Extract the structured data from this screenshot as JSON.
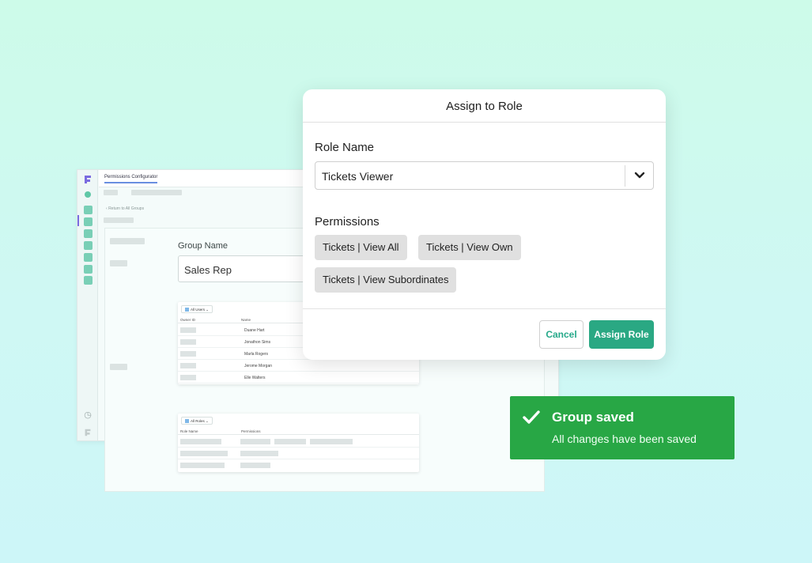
{
  "app": {
    "tab_label": "Permissions Configurator",
    "back_link": "Return to All Groups",
    "group_name_label": "Group Name",
    "group_name_value": "Sales Rep",
    "users_table": {
      "filter_label": "All Users",
      "columns": [
        "Owner ID",
        "Name"
      ],
      "rows": [
        "Duane Hart",
        "Jonathon Sims",
        "Marla Rogers",
        "Jerome Morgan",
        "Elle Walters"
      ]
    },
    "roles_table": {
      "filter_label": "All Roles",
      "columns": [
        "Role Name",
        "Permissions"
      ]
    },
    "sidebar_bottom_icons": [
      "clock-icon",
      "logo-icon"
    ]
  },
  "modal": {
    "title": "Assign to Role",
    "role_name_label": "Role Name",
    "role_name_value": "Tickets Viewer",
    "permissions_label": "Permissions",
    "permissions": [
      "Tickets | View All",
      "Tickets | View Own",
      "Tickets | View Subordinates"
    ],
    "cancel_label": "Cancel",
    "assign_label": "Assign Role"
  },
  "toast": {
    "title": "Group saved",
    "message": "All changes have been saved"
  },
  "colors": {
    "primary": "#2aa883",
    "toast_bg": "#28a745",
    "brand": "#7a6be0"
  }
}
